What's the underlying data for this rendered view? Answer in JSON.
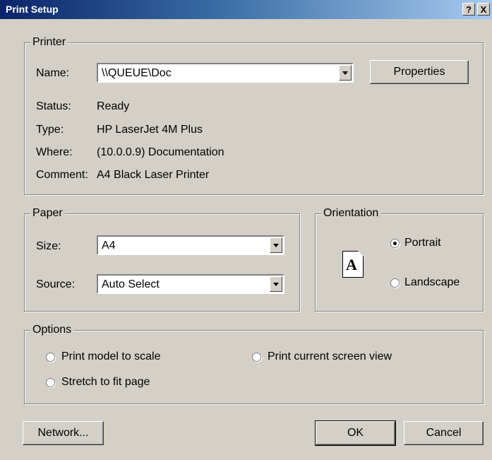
{
  "window": {
    "title": "Print Setup",
    "help_glyph": "?",
    "close_glyph": "X"
  },
  "printer": {
    "group_label": "Printer",
    "name_label": "Name:",
    "name_value": "\\\\QUEUE\\Doc",
    "properties_label": "Properties",
    "status_label": "Status:",
    "status_value": "Ready",
    "type_label": "Type:",
    "type_value": "HP LaserJet 4M Plus",
    "where_label": "Where:",
    "where_value": "(10.0.0.9) Documentation",
    "comment_label": "Comment:",
    "comment_value": "A4 Black Laser Printer"
  },
  "paper": {
    "group_label": "Paper",
    "size_label": "Size:",
    "size_value": "A4",
    "source_label": "Source:",
    "source_value": "Auto Select"
  },
  "orientation": {
    "group_label": "Orientation",
    "icon_letter": "A",
    "portrait_label": "Portrait",
    "landscape_label": "Landscape",
    "selected": "portrait"
  },
  "options": {
    "group_label": "Options",
    "print_model_label": "Print model to scale",
    "stretch_label": "Stretch to fit page",
    "current_view_label": "Print current screen view"
  },
  "buttons": {
    "network_label": "Network...",
    "ok_label": "OK",
    "cancel_label": "Cancel"
  }
}
